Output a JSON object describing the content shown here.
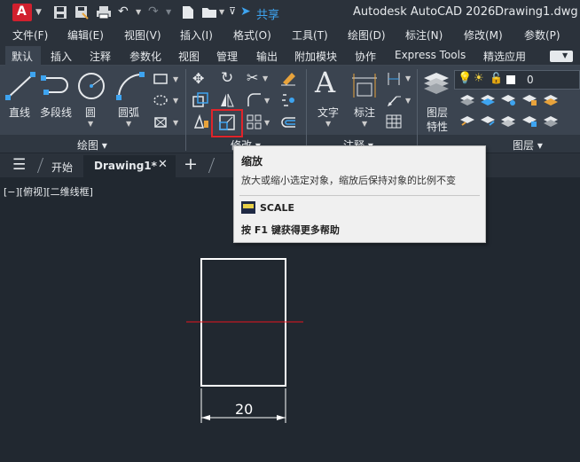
{
  "titlebar": {
    "logo": "A",
    "share_label": "共享",
    "app_title": "Autodesk AutoCAD 2026",
    "file_name": "Drawing1.dwg"
  },
  "menu": [
    "文件(F)",
    "编辑(E)",
    "视图(V)",
    "插入(I)",
    "格式(O)",
    "工具(T)",
    "绘图(D)",
    "标注(N)",
    "修改(M)",
    "参数(P)"
  ],
  "ribbon_tabs": [
    "默认",
    "插入",
    "注释",
    "参数化",
    "视图",
    "管理",
    "输出",
    "附加模块",
    "协作",
    "Express Tools",
    "精选应用"
  ],
  "active_tab": "默认",
  "draw_panel": {
    "line": "直线",
    "polyline": "多段线",
    "circle": "圆",
    "arc": "圆弧",
    "footer": "绘图 ▾"
  },
  "modify_panel": {
    "footer": "修改 ▾"
  },
  "annotation_panel": {
    "text": "文字",
    "dimension": "标注",
    "footer": "注释 ▾"
  },
  "layers_panel": {
    "layer_props_line1": "图层",
    "layer_props_line2": "特性",
    "current_layer": "0",
    "footer": "图层 ▾"
  },
  "doc_tabs": {
    "start": "开始",
    "drawing": "Drawing1*"
  },
  "viewport_label": "[−][俯视][二维线框]",
  "tooltip": {
    "title": "缩放",
    "description": "放大或缩小选定对象，缩放后保持对象的比例不变",
    "command": "SCALE",
    "help": "按 F1 键获得更多帮助"
  },
  "drawing": {
    "dimension_value": "20"
  },
  "colors": {
    "accent_red": "#e8141e",
    "highlight_box": "#e0242a",
    "canvas_bg": "#212830",
    "ribbon_bg": "#3b4450"
  }
}
